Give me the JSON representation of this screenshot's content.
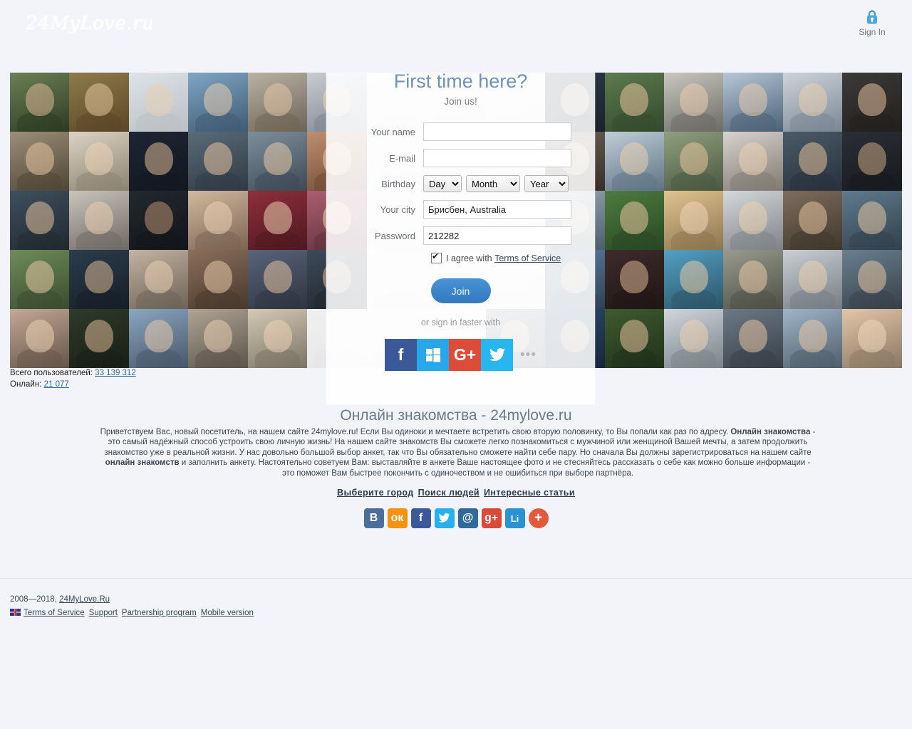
{
  "header": {
    "logo_text": "24MyLove.ru",
    "signin_icon": "lock-icon",
    "signin_label": "Sign In"
  },
  "counters": {
    "total_label": "Всего пользователей:",
    "total_value": "33 139 312",
    "online_label": "Онлайн:",
    "online_value": "21 077"
  },
  "signup": {
    "title": "First time here?",
    "subtitle": "Join us!",
    "fields": {
      "name_label": "Your name",
      "name_value": "",
      "email_label": "E-mail",
      "email_value": "",
      "birthday_label": "Birthday",
      "day_value": "Day",
      "month_value": "Month",
      "year_value": "Year",
      "city_label": "Your city",
      "city_value": "Брисбен, Australia",
      "password_label": "Password",
      "password_value": "212282"
    },
    "agree_prefix": "I agree with",
    "agree_link": "Terms of Service",
    "join_label": "Join",
    "faster_label": "or sign in faster with",
    "socials": [
      {
        "name": "facebook",
        "glyph": "f",
        "class": "soc-fb"
      },
      {
        "name": "microsoft",
        "glyph": "",
        "class": "soc-ms"
      },
      {
        "name": "google-plus",
        "glyph": "G+",
        "class": "soc-gp"
      },
      {
        "name": "twitter",
        "glyph": "",
        "class": "soc-tw"
      }
    ],
    "more_glyph": "•••"
  },
  "seo": {
    "title": "Онлайн знакомства - 24mylove.ru",
    "paragraph_1": "Приветствуем Вас, новый посетитель, на нашем сайте 24mylove.ru! Если Вы одиноки и мечтаете встретить свою вторую половинку, то Вы попали как раз по адресу. ",
    "bold_1": "Онлайн знакомства",
    "paragraph_2": " - это самый надёжный способ устроить свою личную жизнь! На нашем сайте знакомств Вы сможете легко познакомиться с мужчиной или женщиной Вашей мечты, а затем продолжить знакомство уже в реальной жизни. У нас довольно большой выбор анкет, так что Вы обязательно сможете найти себе пару. Но сначала Вы должны зарегистрироваться на нашем сайте ",
    "bold_2": "онлайн знакомств",
    "paragraph_3": " и заполнить анкету. Настоятельно советуем Вам: выставляйте в анкете Ваше настоящее фото и не стесняйтесь рассказать о себе как можно больше информации - это поможет Вам быстрее покончить с одиночеством и не ошибиться при выборе партнёра.",
    "links": [
      {
        "label": "Выберите город"
      },
      {
        "label": "Поиск людей"
      },
      {
        "label": "Интересные статьи"
      }
    ]
  },
  "share_buttons": [
    {
      "name": "vkontakte",
      "glyph": "B",
      "class": "sh-vk"
    },
    {
      "name": "odnoklassniki",
      "glyph": "ок",
      "class": "sh-ok"
    },
    {
      "name": "facebook",
      "glyph": "f",
      "class": "sh-fb"
    },
    {
      "name": "twitter",
      "glyph": "",
      "class": "sh-tw"
    },
    {
      "name": "mail-ru",
      "glyph": "@",
      "class": "sh-mail"
    },
    {
      "name": "google-plus",
      "glyph": "g+",
      "class": "sh-gp"
    },
    {
      "name": "livejournal",
      "glyph": "Li",
      "class": "sh-li"
    },
    {
      "name": "more-share",
      "glyph": "+",
      "class": "sh-plus"
    }
  ],
  "footer": {
    "copyright": "2008—2018, ",
    "brand_link": "24MyLove.Ru",
    "flag_icon": "uk-flag-icon",
    "links": [
      {
        "label": "Terms of Service"
      },
      {
        "label": "Support"
      },
      {
        "label": "Partnership program"
      },
      {
        "label": "Mobile version"
      }
    ]
  },
  "photo_grid": {
    "columns": 15,
    "rows": 5,
    "tiles": [
      {
        "bg": "#6d7f56",
        "face": "#d8b593",
        "body": "#2c3b22"
      },
      {
        "bg": "#8e7b4a",
        "face": "#e4c49a",
        "body": "#5a4628"
      },
      {
        "bg": "#dde3e6",
        "face": "#e8cfb4",
        "body": "#b9c0c4"
      },
      {
        "bg": "#7fa6c4",
        "face": "#e7cdb2",
        "body": "#3f5a73"
      },
      {
        "bg": "#b9b2a4",
        "face": "#e3c6a6",
        "body": "#6d6356"
      },
      {
        "bg": "#c9cdd2",
        "face": "#e8d0b6",
        "body": "#7b8490"
      },
      {
        "bg": "#f1f1f2",
        "face": "#f0f0f0",
        "body": "#e6e6e8"
      },
      {
        "bg": "#efefef",
        "face": "#ededed",
        "body": "#e4e4e6"
      },
      {
        "bg": "#efefef",
        "face": "#ececec",
        "body": "#e3e3e5"
      },
      {
        "bg": "#2d3a4a",
        "face": "#e6c9ad",
        "body": "#1a222c"
      },
      {
        "bg": "#5d7a4e",
        "face": "#e7c39c",
        "body": "#33492c"
      },
      {
        "bg": "#c9c7c0",
        "face": "#e9cdae",
        "body": "#6b6a64"
      },
      {
        "bg": "#b7c7d6",
        "face": "#e7cbae",
        "body": "#4b6076"
      },
      {
        "bg": "#cfd4d9",
        "face": "#ead0b3",
        "body": "#7a8694"
      },
      {
        "bg": "#3c3a38",
        "face": "#e0bd9c",
        "body": "#221f1d"
      },
      {
        "bg": "#9c8f78",
        "face": "#e4c29e",
        "body": "#4f4536"
      },
      {
        "bg": "#dcd3c4",
        "face": "#ecd1b4",
        "body": "#8b8371"
      },
      {
        "bg": "#1e2533",
        "face": "#d9b894",
        "body": "#121720"
      },
      {
        "bg": "#5b6b78",
        "face": "#e3c3a2",
        "body": "#2f3a44"
      },
      {
        "bg": "#7d8e9b",
        "face": "#e6c8a8",
        "body": "#3d4a55"
      },
      {
        "bg": "#c08e6e",
        "face": "#eac9a7",
        "body": "#6b4a33"
      },
      {
        "bg": "#f0f0f1",
        "face": "#eeeeef",
        "body": "#e5e5e7"
      },
      {
        "bg": "#efeff0",
        "face": "#ededee",
        "body": "#e3e3e5"
      },
      {
        "bg": "#efeff0",
        "face": "#ececed",
        "body": "#e3e3e5"
      },
      {
        "bg": "#6a6258",
        "face": "#e3c3a0",
        "body": "#372f28"
      },
      {
        "bg": "#c0cdd7",
        "face": "#ebd0b2",
        "body": "#5e7384"
      },
      {
        "bg": "#8fa07e",
        "face": "#e5c59f",
        "body": "#4a5840"
      },
      {
        "bg": "#d8d4cd",
        "face": "#ecd2b4",
        "body": "#7e7a72"
      },
      {
        "bg": "#4b5a68",
        "face": "#e0bf9d",
        "body": "#27313b"
      },
      {
        "bg": "#2a2f36",
        "face": "#c9a582",
        "body": "#16191e"
      },
      {
        "bg": "#3f4f5e",
        "face": "#e1c09e",
        "body": "#20292f"
      },
      {
        "bg": "#c9c4bc",
        "face": "#ead0b1",
        "body": "#6e6a63"
      },
      {
        "bg": "#23282f",
        "face": "#b99271",
        "body": "#12151a"
      },
      {
        "bg": "#d2b8a0",
        "face": "#edd2b5",
        "body": "#7a6452"
      },
      {
        "bg": "#8e2f3c",
        "face": "#e9cdaf",
        "body": "#4e1820"
      },
      {
        "bg": "#ab5e70",
        "face": "#ecd0b2",
        "body": "#5e2f3c"
      },
      {
        "bg": "#f0f0f1",
        "face": "#eeeeef",
        "body": "#e6e6e8"
      },
      {
        "bg": "#efeff0",
        "face": "#ededee",
        "body": "#e4e4e6"
      },
      {
        "bg": "#eeeef0",
        "face": "#ececed",
        "body": "#e3e3e5"
      },
      {
        "bg": "#9aa9b6",
        "face": "#e7c9a9",
        "body": "#4e5d6b"
      },
      {
        "bg": "#4d7c3f",
        "face": "#e5c49e",
        "body": "#2a4623"
      },
      {
        "bg": "#e0c48f",
        "face": "#efd5b7",
        "body": "#8b7450"
      },
      {
        "bg": "#d6d9db",
        "face": "#ecd1b3",
        "body": "#7d8286"
      },
      {
        "bg": "#7e6d5c",
        "face": "#e2c19e",
        "body": "#40372d"
      },
      {
        "bg": "#5f7b8e",
        "face": "#e4c5a3",
        "body": "#31404c"
      },
      {
        "bg": "#6f8c5a",
        "face": "#e6c7a4",
        "body": "#3a4c2f"
      },
      {
        "bg": "#2c3c4c",
        "face": "#d9b894",
        "body": "#161e26"
      },
      {
        "bg": "#c3b3a2",
        "face": "#ead0b2",
        "body": "#6c6256"
      },
      {
        "bg": "#8b6f5a",
        "face": "#e6c8a5",
        "body": "#47382d"
      },
      {
        "bg": "#59647a",
        "face": "#e1c09e",
        "body": "#2e3541"
      },
      {
        "bg": "#3c4a58",
        "face": "#deba96",
        "body": "#1f262e"
      },
      {
        "bg": "#f0f0f1",
        "face": "#eeeeef",
        "body": "#e6e6e8"
      },
      {
        "bg": "#efeff0",
        "face": "#ededee",
        "body": "#e4e4e6"
      },
      {
        "bg": "#eeeef0",
        "face": "#ececed",
        "body": "#e3e3e5"
      },
      {
        "bg": "#5b7da0",
        "face": "#e5c6a4",
        "body": "#2f4154"
      },
      {
        "bg": "#3d2b2a",
        "face": "#d7b48f",
        "body": "#1f1615"
      },
      {
        "bg": "#53a0c4",
        "face": "#e8cbaa",
        "body": "#2b5466"
      },
      {
        "bg": "#989b8c",
        "face": "#e7c9a7",
        "body": "#4d4f46"
      },
      {
        "bg": "#c9cfd5",
        "face": "#ebd0b2",
        "body": "#757c83"
      },
      {
        "bg": "#6a7f8f",
        "face": "#e3c3a1",
        "body": "#364049"
      },
      {
        "bg": "#c3a896",
        "face": "#ecd1b3",
        "body": "#655549"
      },
      {
        "bg": "#2f3b2a",
        "face": "#d9b894",
        "body": "#181e15"
      },
      {
        "bg": "#8aa7c0",
        "face": "#e7caa9",
        "body": "#47566a"
      },
      {
        "bg": "#b0a495",
        "face": "#e9ceb0",
        "body": "#5b544b"
      },
      {
        "bg": "#d3c9b6",
        "face": "#edd3b6",
        "body": "#7a7365"
      },
      {
        "bg": "#f0f0f1",
        "face": "#eeeeef",
        "body": "#e6e6e8"
      },
      {
        "bg": "#efeff0",
        "face": "#ededee",
        "body": "#e4e4e6"
      },
      {
        "bg": "#eeeef0",
        "face": "#ececed",
        "body": "#e3e3e5"
      },
      {
        "bg": "#7e8e9c",
        "face": "#e5c6a5",
        "body": "#3f4a55"
      },
      {
        "bg": "#2a4a6e",
        "face": "#deba96",
        "body": "#16263a"
      },
      {
        "bg": "#3e5b2f",
        "face": "#e2c09d",
        "body": "#203019"
      },
      {
        "bg": "#cfd6dc",
        "face": "#ecd1b3",
        "body": "#79828a"
      },
      {
        "bg": "#6c7a86",
        "face": "#e3c3a1",
        "body": "#373f47"
      },
      {
        "bg": "#9fb5c8",
        "face": "#e8cbab",
        "body": "#4f5d6a"
      },
      {
        "bg": "#e2c6a7",
        "face": "#f0d8bc",
        "body": "#8a7764"
      }
    ]
  }
}
